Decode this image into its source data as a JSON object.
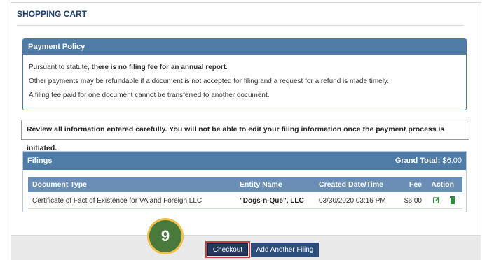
{
  "header": {
    "title": "SHOPPING CART"
  },
  "policy": {
    "title": "Payment Policy",
    "line1_prefix": "Pursuant to statute, ",
    "line1_bold": "there is no filing fee for an annual report",
    "line1_suffix": ".",
    "line2": "Other payments may be refundable if a document is not accepted for filing and a request for a refund is made timely.",
    "line3": "A filing fee paid for one document cannot be transferred to another document."
  },
  "review": {
    "text": "Review all information entered carefully. You will not be able to edit your filing information once the payment process is initiated."
  },
  "filings": {
    "title": "Filings",
    "grand_total_label": "Grand Total:",
    "grand_total_value": "$6.00",
    "columns": [
      "Document Type",
      "Entity Name",
      "Created Date/Time",
      "Fee",
      "Action"
    ],
    "rows": [
      {
        "document_type": "Certificate of Fact of Existence for VA and Foreign LLC",
        "entity_name": "\"Dogs-n-Que\", LLC",
        "created": "03/30/2020 03:16 PM",
        "fee": "$6.00",
        "actions": [
          "edit-icon",
          "trash-icon"
        ]
      }
    ]
  },
  "step_badge": {
    "number": "9"
  },
  "buttons": {
    "checkout": "Checkout",
    "add_another": "Add Another Filing"
  },
  "colors": {
    "panel_header": "#4f7ba7",
    "table_header": "#6a8eb5",
    "button": "#233a5e",
    "highlight": "#d63b3b",
    "badge": "#4a7a3b",
    "badge_border": "#f1c04a",
    "action_icon": "#2e8b3c"
  }
}
